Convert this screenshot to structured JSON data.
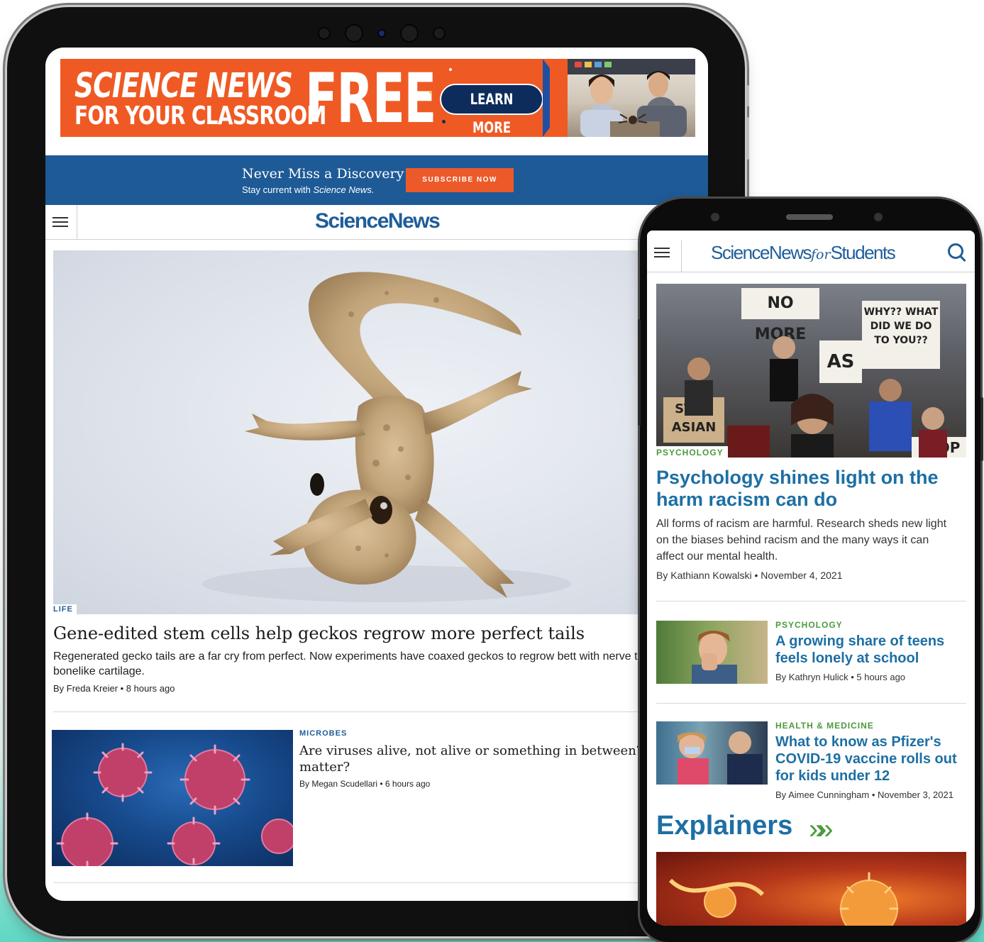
{
  "tablet": {
    "promo": {
      "line1": "SCIENCE NEWS",
      "line2": "FOR YOUR CLASSROOM",
      "free": "FREE",
      "button": "LEARN MORE"
    },
    "subscribe": {
      "title": "Never Miss a Discovery",
      "subtitle_prefix": "Stay current with",
      "subtitle_brand": "Science News.",
      "button": "SUBSCRIBE NOW"
    },
    "logo": "ScienceNews",
    "hero": {
      "tag": "LIFE",
      "title": "Gene-edited stem cells help geckos regrow more perfect tails",
      "summary": "Regenerated gecko tails are a far cry from perfect. Now experiments have coaxed geckos to regrow bett with nerve tissue and bonelike cartilage.",
      "byline": "By Freda Kreier • 8 hours ago"
    },
    "second": {
      "tag": "MICROBES",
      "title": "Are viruses alive, not alive or something in between? why does it matter?",
      "byline": "By Megan Scudellari • 6 hours ago"
    }
  },
  "phone": {
    "logo_a": "ScienceNews",
    "logo_for": "for",
    "logo_b": "Students",
    "hero_signs": {
      "sign1": "NO MORE",
      "sign2": "WHY?? WHAT DID WE DO TO YOU??",
      "sign3": "STOP ASIAN",
      "sign4": "STOP",
      "sign5": "AS"
    },
    "hero": {
      "tag": "PSYCHOLOGY",
      "title": "Psychology shines light on the harm racism can do",
      "summary": "All forms of racism are harmful. Research sheds new light on the biases behind racism and the many ways it can affect our mental health.",
      "byline": "By Kathiann Kowalski • November 4, 2021"
    },
    "story2": {
      "tag": "PSYCHOLOGY",
      "title": "A growing share of teens feels lonely at school",
      "byline": "By Kathryn Hulick • 5 hours ago"
    },
    "story3": {
      "tag": "HEALTH & MEDICINE",
      "title": "What to know as Pfizer's COVID-19 vaccine rolls out for kids under 12",
      "byline": "By Aimee Cunningham • November 3, 2021"
    },
    "explainers": "Explainers",
    "explainers_chevrons": "»»"
  }
}
